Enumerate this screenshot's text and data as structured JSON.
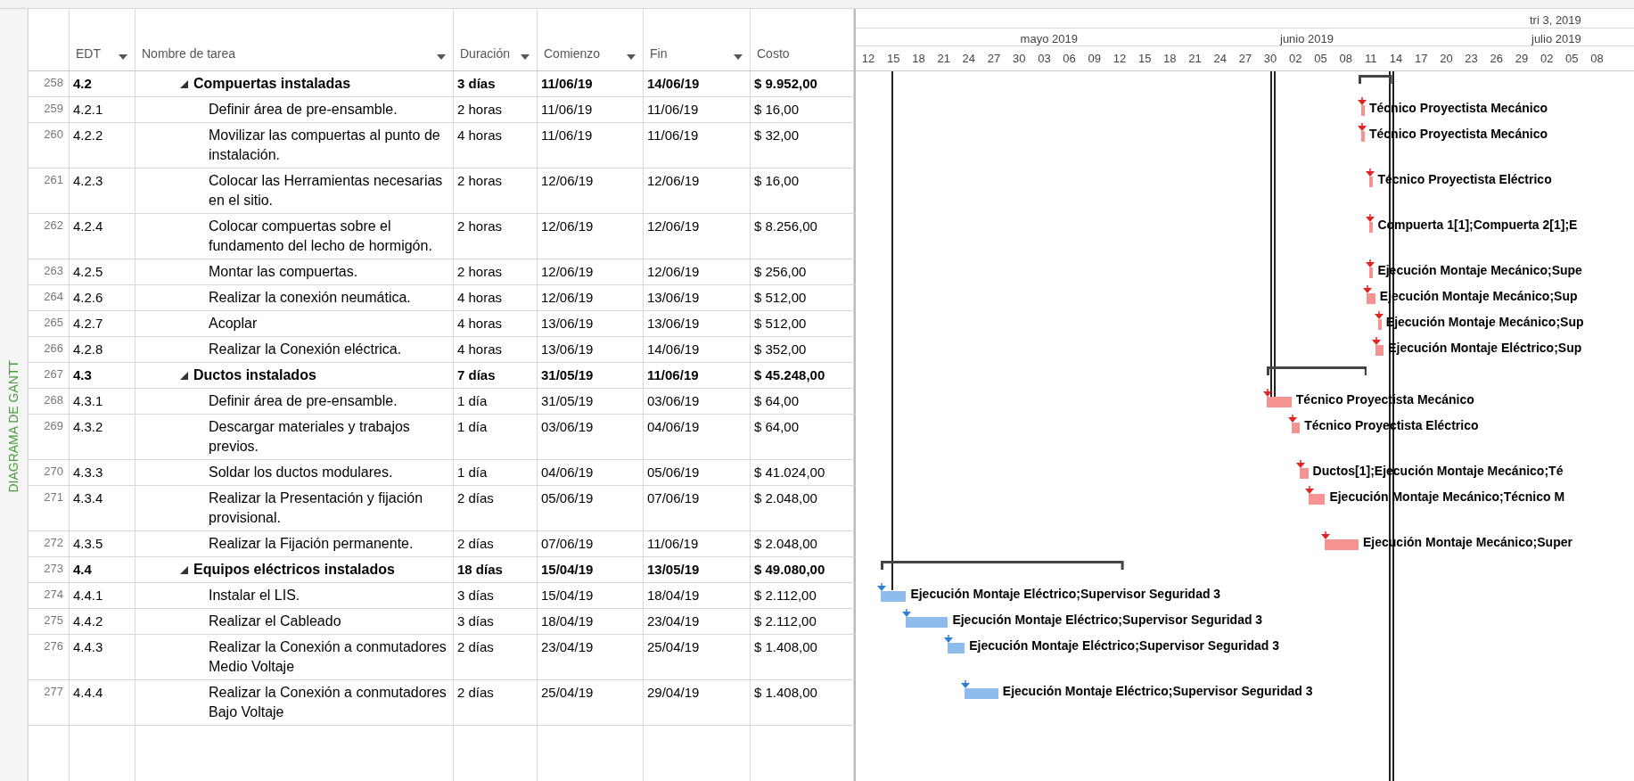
{
  "side_label": "DIAGRAMA DE GANTT",
  "columns": [
    {
      "label": "EDT",
      "filter": true
    },
    {
      "label": "Nombre de tarea",
      "filter": true
    },
    {
      "label": "Duración",
      "filter": true
    },
    {
      "label": "Comienzo",
      "filter": true
    },
    {
      "label": "Fin",
      "filter": true
    },
    {
      "label": "Costo",
      "filter": false
    }
  ],
  "timescale": {
    "quarters": [
      "tri 3, 2019"
    ],
    "months": [
      "mayo 2019",
      "junio 2019",
      "julio 2019"
    ],
    "days": [
      "12",
      "15",
      "18",
      "21",
      "24",
      "27",
      "30",
      "03",
      "06",
      "09",
      "12",
      "15",
      "18",
      "21",
      "24",
      "27",
      "30",
      "02",
      "05",
      "08",
      "11",
      "14",
      "17",
      "20",
      "23",
      "26",
      "29",
      "02",
      "05",
      "08"
    ]
  },
  "tasks": [
    {
      "row": "258",
      "wbs": "4.2",
      "name": "Compuertas instaladas",
      "duration": "3 días",
      "start": "11/06/19",
      "finish": "14/06/19",
      "cost": "$ 9.952,00",
      "kind": "summary",
      "expanded": true,
      "children": [
        {
          "row": "259",
          "wbs": "4.2.1",
          "name": "Definir área de pre-ensamble.",
          "duration": "2 horas",
          "start": "11/06/19",
          "finish": "11/06/19",
          "cost": "$ 16,00",
          "kind": "task",
          "critical": true,
          "resources": "Técnico Proyectista Mecánico"
        },
        {
          "row": "260",
          "wbs": "4.2.2",
          "name": "Movilizar las compuertas al punto de instalación.",
          "duration": "4 horas",
          "start": "11/06/19",
          "finish": "11/06/19",
          "cost": "$ 32,00",
          "kind": "task",
          "critical": true,
          "resources": "Técnico Proyectista Mecánico"
        },
        {
          "row": "261",
          "wbs": "4.2.3",
          "name": "Colocar las Herramientas necesarias en el sitio.",
          "duration": "2 horas",
          "start": "12/06/19",
          "finish": "12/06/19",
          "cost": "$ 16,00",
          "kind": "task",
          "critical": true,
          "resources": "Técnico Proyectista Eléctrico"
        },
        {
          "row": "262",
          "wbs": "4.2.4",
          "name": "Colocar compuertas sobre el fundamento del lecho de hormigón.",
          "duration": "2 horas",
          "start": "12/06/19",
          "finish": "12/06/19",
          "cost": "$ 8.256,00",
          "kind": "task",
          "critical": true,
          "resources": "Compuerta 1[1];Compuerta 2[1];E"
        },
        {
          "row": "263",
          "wbs": "4.2.5",
          "name": "Montar las compuertas.",
          "duration": "2 horas",
          "start": "12/06/19",
          "finish": "12/06/19",
          "cost": "$ 256,00",
          "kind": "task",
          "critical": true,
          "resources": "Ejecución Montaje Mecánico;Supe"
        },
        {
          "row": "264",
          "wbs": "4.2.6",
          "name": "Realizar la conexión neumática.",
          "duration": "4 horas",
          "start": "12/06/19",
          "finish": "13/06/19",
          "cost": "$ 512,00",
          "kind": "task",
          "critical": true,
          "resources": "Ejecución Montaje Mecánico;Sup"
        },
        {
          "row": "265",
          "wbs": "4.2.7",
          "name": "Acoplar",
          "duration": "4 horas",
          "start": "13/06/19",
          "finish": "13/06/19",
          "cost": "$ 512,00",
          "kind": "task",
          "critical": true,
          "resources": "Ejecución Montaje Mecánico;Sup"
        },
        {
          "row": "266",
          "wbs": "4.2.8",
          "name": "Realizar la Conexión eléctrica.",
          "duration": "4 horas",
          "start": "13/06/19",
          "finish": "14/06/19",
          "cost": "$ 352,00",
          "kind": "task",
          "critical": true,
          "resources": "Ejecución Montaje Eléctrico;Sup"
        }
      ]
    },
    {
      "row": "267",
      "wbs": "4.3",
      "name": "Ductos instalados",
      "duration": "7 días",
      "start": "31/05/19",
      "finish": "11/06/19",
      "cost": "$ 45.248,00",
      "kind": "summary",
      "expanded": true,
      "children": [
        {
          "row": "268",
          "wbs": "4.3.1",
          "name": "Definir área de pre-ensamble.",
          "duration": "1 día",
          "start": "31/05/19",
          "finish": "03/06/19",
          "cost": "$ 64,00",
          "kind": "task",
          "critical": true,
          "resources": "Técnico Proyectista Mecánico"
        },
        {
          "row": "269",
          "wbs": "4.3.2",
          "name": "Descargar materiales y trabajos previos.",
          "duration": "1 día",
          "start": "03/06/19",
          "finish": "04/06/19",
          "cost": "$ 64,00",
          "kind": "task",
          "critical": true,
          "resources": "Técnico Proyectista Eléctrico"
        },
        {
          "row": "270",
          "wbs": "4.3.3",
          "name": "Soldar los ductos modulares.",
          "duration": "1 día",
          "start": "04/06/19",
          "finish": "05/06/19",
          "cost": "$ 41.024,00",
          "kind": "task",
          "critical": true,
          "resources": "Ductos[1];Ejecución Montaje Mecánico;Té"
        },
        {
          "row": "271",
          "wbs": "4.3.4",
          "name": "Realizar la Presentación y fijación provisional.",
          "duration": "2 días",
          "start": "05/06/19",
          "finish": "07/06/19",
          "cost": "$ 2.048,00",
          "kind": "task",
          "critical": true,
          "resources": "Ejecución Montaje Mecánico;Técnico M"
        },
        {
          "row": "272",
          "wbs": "4.3.5",
          "name": "Realizar la Fijación permanente.",
          "duration": "2 días",
          "start": "07/06/19",
          "finish": "11/06/19",
          "cost": "$ 2.048,00",
          "kind": "task",
          "critical": true,
          "resources": "Ejecución Montaje Mecánico;Super"
        }
      ]
    },
    {
      "row": "273",
      "wbs": "4.4",
      "name": "Equipos eléctricos instalados",
      "duration": "18 días",
      "start": "15/04/19",
      "finish": "13/05/19",
      "cost": "$ 49.080,00",
      "kind": "summary",
      "expanded": true,
      "children": [
        {
          "row": "274",
          "wbs": "4.4.1",
          "name": "Instalar el LIS.",
          "duration": "3 días",
          "start": "15/04/19",
          "finish": "18/04/19",
          "cost": "$ 2.112,00",
          "kind": "task",
          "critical": false,
          "resources": "Ejecución Montaje Eléctrico;Supervisor Seguridad 3"
        },
        {
          "row": "275",
          "wbs": "4.4.2",
          "name": "Realizar el Cableado",
          "duration": "3 días",
          "start": "18/04/19",
          "finish": "23/04/19",
          "cost": "$ 2.112,00",
          "kind": "task",
          "critical": false,
          "resources": "Ejecución Montaje Eléctrico;Supervisor Seguridad 3"
        },
        {
          "row": "276",
          "wbs": "4.4.3",
          "name": "Realizar la Conexión a conmutadores Medio Voltaje",
          "duration": "2 días",
          "start": "23/04/19",
          "finish": "25/04/19",
          "cost": "$ 1.408,00",
          "kind": "task",
          "critical": false,
          "resources": "Ejecución Montaje Eléctrico;Supervisor Seguridad 3"
        },
        {
          "row": "277",
          "wbs": "4.4.4",
          "name": "Realizar la Conexión a conmutadores Bajo Voltaje",
          "duration": "2 días",
          "start": "25/04/19",
          "finish": "29/04/19",
          "cost": "$ 1.408,00",
          "kind": "task",
          "critical": false,
          "resources": "Ejecución Montaje Eléctrico;Supervisor Seguridad 3"
        }
      ]
    }
  ]
}
